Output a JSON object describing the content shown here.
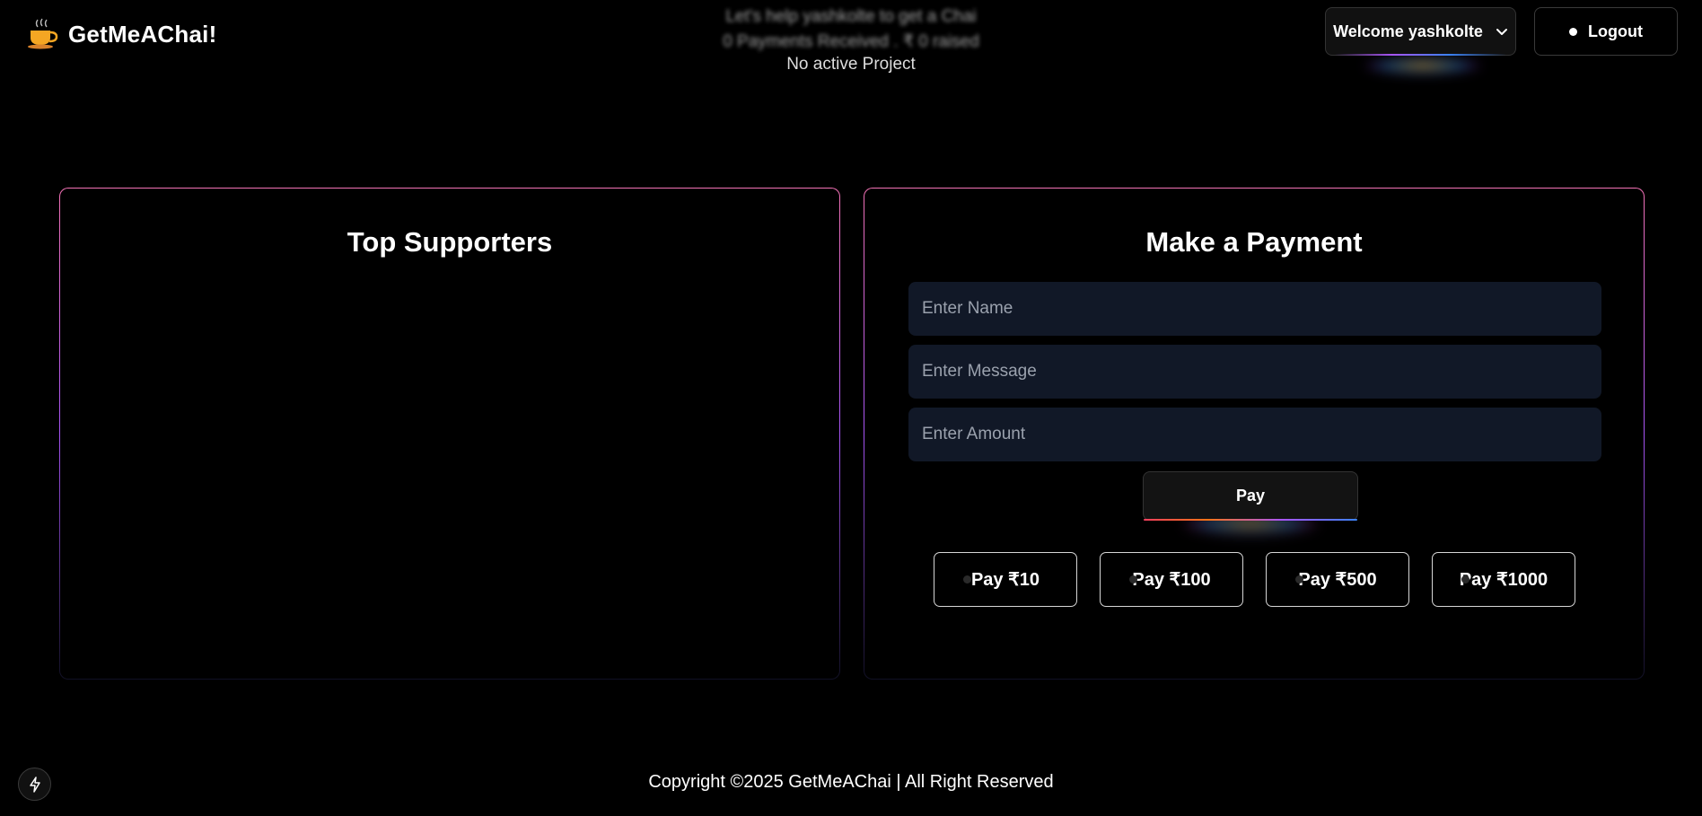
{
  "brand": {
    "name": "GetMeAChai!",
    "icon": "chai-cup-icon"
  },
  "banner": {
    "line1": "Let's help yashkolte to get a Chai",
    "line2": "0 Payments Received . ₹ 0 raised",
    "line3": "No active Project"
  },
  "header": {
    "welcome_label": "Welcome yashkolte",
    "logout_label": "Logout"
  },
  "supporters": {
    "title": "Top Supporters"
  },
  "payment": {
    "title": "Make a Payment",
    "name_placeholder": "Enter Name",
    "message_placeholder": "Enter Message",
    "amount_placeholder": "Enter Amount",
    "pay_label": "Pay",
    "quick_amounts": [
      "Pay ₹10",
      "Pay ₹100",
      "Pay ₹500",
      "Pay ₹1000"
    ]
  },
  "footer": {
    "copyright": "Copyright ©2025 GetMeAChai | All Right Reserved"
  },
  "colors": {
    "background": "#000000",
    "input_bg": "#111827",
    "border_gradient_start": "#f472b6",
    "border_gradient_end": "#a855f7"
  }
}
